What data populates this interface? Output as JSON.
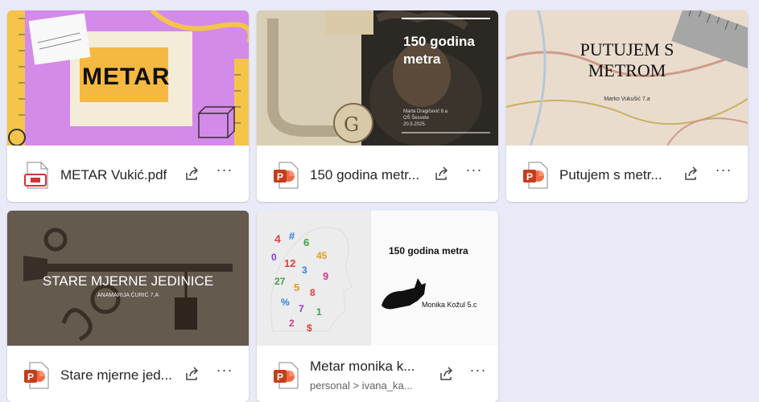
{
  "files": [
    {
      "name": "METAR Vukić.pdf",
      "path": "",
      "type": "pdf",
      "thumb_title": "METAR"
    },
    {
      "name": "150 godina metr...",
      "path": "",
      "type": "ppt",
      "thumb_title": "150 godina metra",
      "thumb_lines": [
        "Marta Dragičević 8.a",
        "OŠ Šesvete",
        "20.5.2025."
      ]
    },
    {
      "name": "Putujem s metr...",
      "path": "",
      "type": "ppt",
      "thumb_title": "PUTUJEM S METROM",
      "thumb_author": "Marko Vukušić 7.a"
    },
    {
      "name": "Stare mjerne jed...",
      "path": "",
      "type": "ppt",
      "thumb_title": "STARE MJERNE JEDINICE",
      "thumb_author": "ANAMARIJA ĆURIĆ 7.A"
    },
    {
      "name": "Metar monika k...",
      "path": "personal > ivana_ka...",
      "type": "ppt",
      "thumb_title": "150 godina metra",
      "thumb_author": "Monika Kožul 5.c"
    }
  ],
  "icons": {
    "share": "share-icon",
    "more": "more-options-icon",
    "pdf": "pdf-file-icon",
    "ppt": "powerpoint-file-icon"
  },
  "colors": {
    "background": "#e8eaf7",
    "ppt_red": "#c43e1c",
    "pdf_red": "#d13438"
  }
}
